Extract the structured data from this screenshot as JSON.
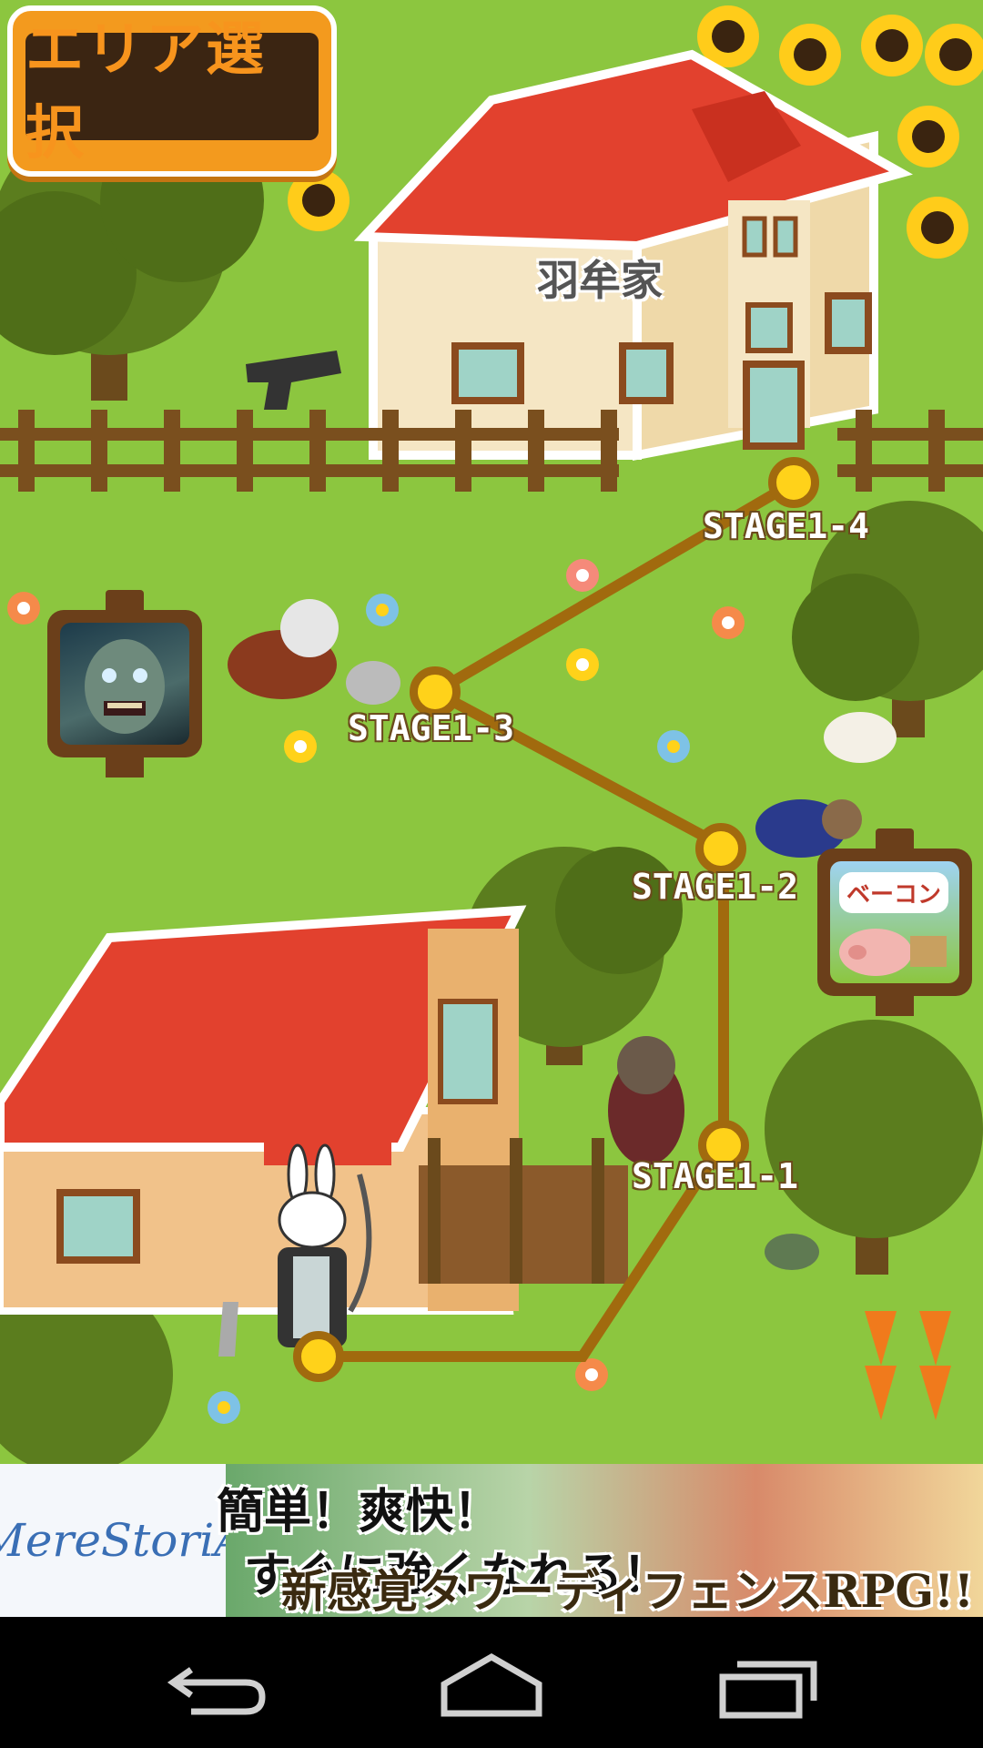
{
  "header": {
    "area_select_label": "エリア選択"
  },
  "map": {
    "house_label": "羽牟家",
    "stages": [
      {
        "id": "stage-1-1",
        "label": "STAGE1-1"
      },
      {
        "id": "stage-1-2",
        "label": "STAGE1-2"
      },
      {
        "id": "stage-1-3",
        "label": "STAGE1-3"
      },
      {
        "id": "stage-1-4",
        "label": "STAGE1-4"
      }
    ],
    "right_sign_tag": "ベーコン"
  },
  "ad": {
    "logo_text": "MereStoriA",
    "copy_line1": "簡単！爽快！",
    "copy_line2": "すぐに強くなれる！",
    "copy_line3": "新感覚タワーディフェンスRPG!!"
  },
  "colors": {
    "grass": "#8cc63f",
    "path": "#a16a0e",
    "node": "#ffd21a",
    "button": "#f39a1e",
    "roof": "#e2412e"
  },
  "icons": {
    "back": "back-icon",
    "home": "home-icon",
    "recents": "recents-icon"
  }
}
